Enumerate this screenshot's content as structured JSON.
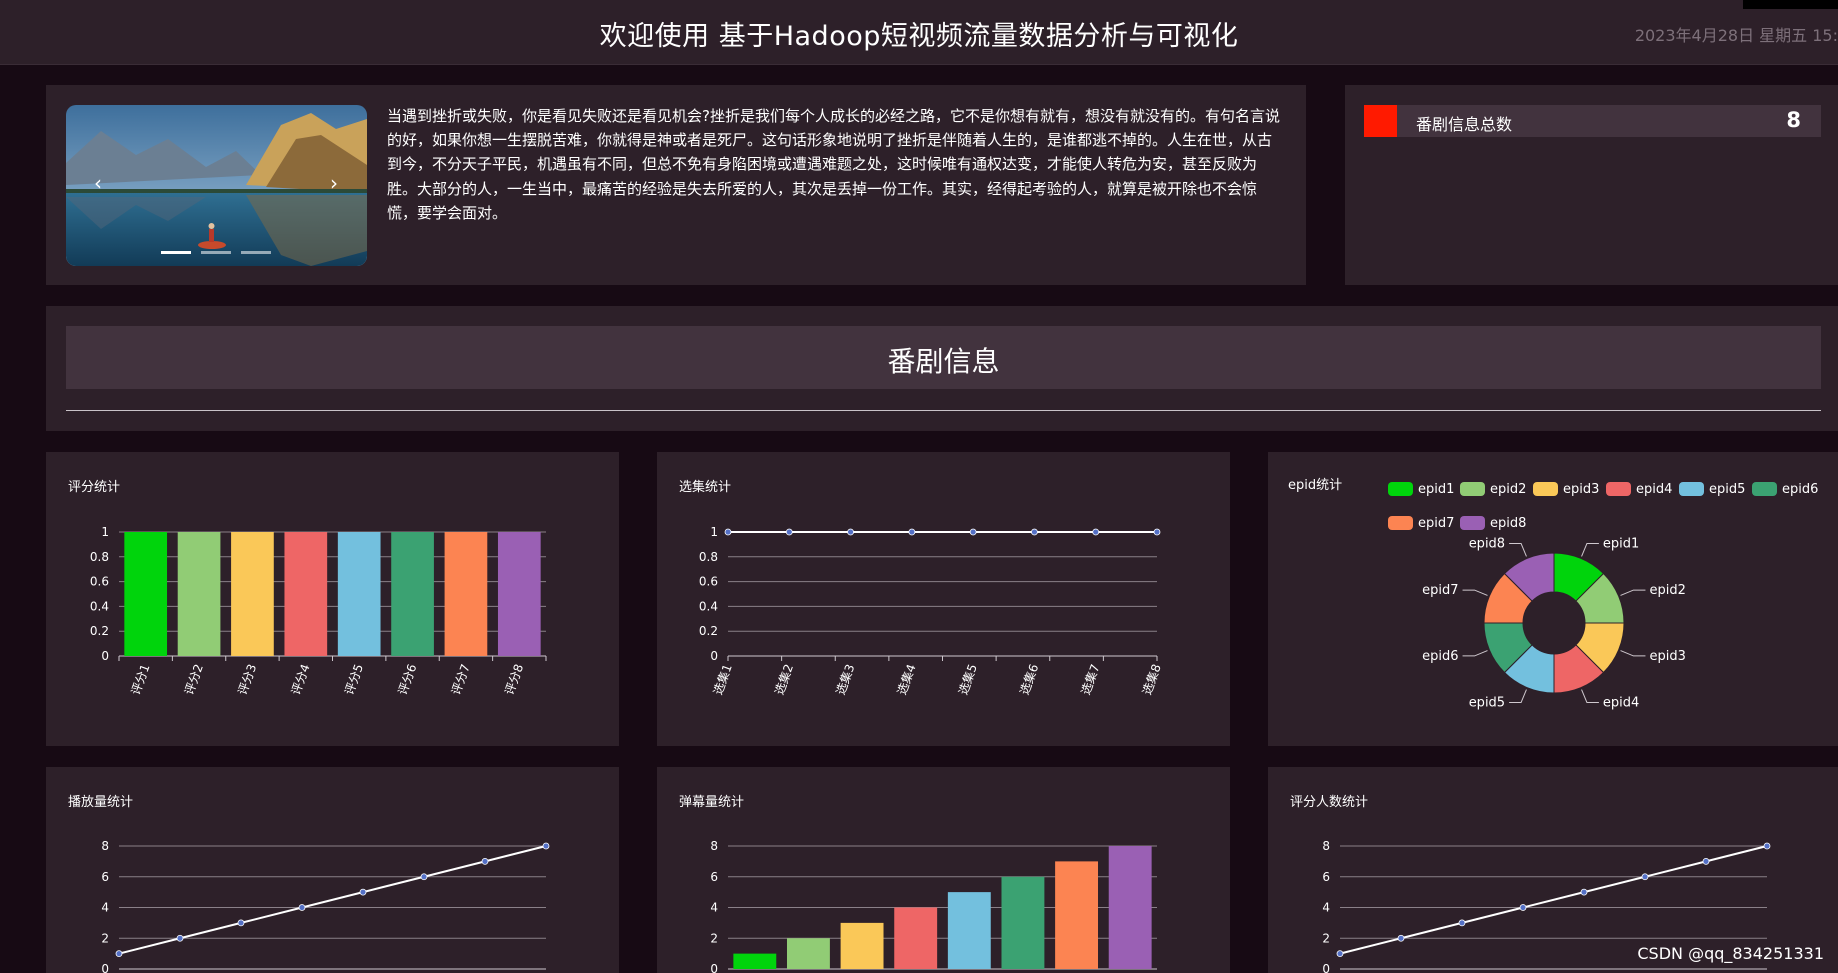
{
  "header": {
    "title": "欢迎使用 基于Hadoop短视频流量数据分析与可视化",
    "datetime": "2023年4月28日 星期五 15:"
  },
  "intro": {
    "image_icon": "mountain-lake-photo",
    "prev_arrow": "‹",
    "next_arrow": "›",
    "text": "当遇到挫折或失败，你是看见失败还是看见机会?挫折是我们每个人成长的必经之路，它不是你想有就有，想没有就没有的。有句名言说的好，如果你想一生摆脱苦难，你就得是神或者是死尸。这句话形象地说明了挫折是伴随着人生的，是谁都逃不掉的。人生在世，从古到今，不分天子平民，机遇虽有不同，但总不免有身陷困境或遭遇难题之处，这时候唯有通权达变，才能使人转危为安，甚至反败为胜。大部分的人，一生当中，最痛苦的经验是失去所爱的人，其次是丢掉一份工作。其实，经得起考验的人，就算是被开除也不会惊慌，要学会面对。"
  },
  "stats": {
    "label": "番剧信息总数",
    "value": "8",
    "swatch_color": "#ff1a00"
  },
  "section": {
    "title": "番剧信息"
  },
  "palette": [
    "#00d40c",
    "#91cc75",
    "#fac858",
    "#ee6666",
    "#73c0de",
    "#3ba272",
    "#fc8452",
    "#9a60b4"
  ],
  "line_color": "#ffffff",
  "point_color": "#5470c6",
  "chart_data": [
    {
      "type": "bar",
      "title": "评分统计",
      "categories": [
        "评分1",
        "评分2",
        "评分3",
        "评分4",
        "评分5",
        "评分6",
        "评分7",
        "评分8"
      ],
      "values": [
        1,
        1,
        1,
        1,
        1,
        1,
        1,
        1
      ],
      "yticks": [
        "0",
        "0.2",
        "0.4",
        "0.6",
        "0.8",
        "1"
      ],
      "ylim": [
        0,
        1
      ],
      "grid": true,
      "per_bar_colors": true
    },
    {
      "type": "line",
      "title": "选集统计",
      "categories": [
        "选集1",
        "选集2",
        "选集3",
        "选集4",
        "选集5",
        "选集6",
        "选集7",
        "选集8"
      ],
      "values": [
        1,
        1,
        1,
        1,
        1,
        1,
        1,
        1
      ],
      "yticks": [
        "0",
        "0.2",
        "0.4",
        "0.6",
        "0.8",
        "1"
      ],
      "ylim": [
        0,
        1
      ],
      "grid": true
    },
    {
      "type": "pie",
      "title": "epid统计",
      "donut": true,
      "labels": [
        "epid1",
        "epid2",
        "epid3",
        "epid4",
        "epid5",
        "epid6",
        "epid7",
        "epid8"
      ],
      "values": [
        1,
        1,
        1,
        1,
        1,
        1,
        1,
        1
      ],
      "legend": "top"
    },
    {
      "type": "line",
      "title": "播放量统计",
      "values": [
        1,
        2,
        3,
        4,
        5,
        6,
        7,
        8
      ],
      "yticks": [
        "0",
        "2",
        "4",
        "6",
        "8"
      ],
      "ylim": [
        0,
        8
      ],
      "grid": true
    },
    {
      "type": "bar",
      "title": "弹幕量统计",
      "values": [
        1,
        2,
        3,
        4,
        5,
        6,
        7,
        8
      ],
      "yticks": [
        "0",
        "2",
        "4",
        "6",
        "8"
      ],
      "ylim": [
        0,
        8
      ],
      "grid": true,
      "per_bar_colors": true
    },
    {
      "type": "line",
      "title": "评分人数统计",
      "values": [
        1,
        2,
        3,
        4,
        5,
        6,
        7,
        8
      ],
      "yticks": [
        "0",
        "2",
        "4",
        "6",
        "8"
      ],
      "ylim": [
        0,
        8
      ],
      "grid": true
    }
  ],
  "watermark": "CSDN @qq_834251331"
}
